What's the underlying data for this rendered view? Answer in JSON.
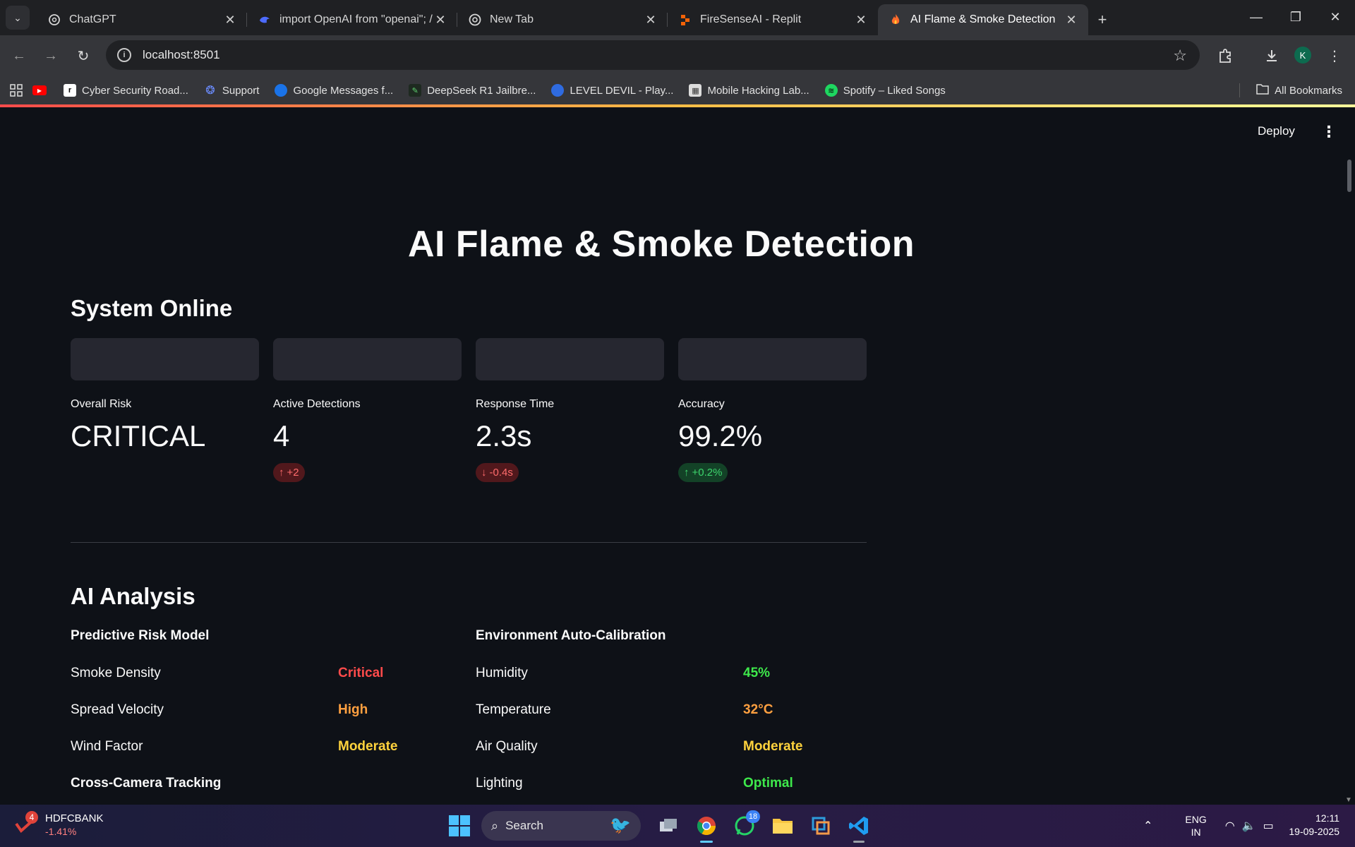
{
  "browser": {
    "tabs": [
      {
        "title": "ChatGPT",
        "icon": "chatgpt-icon"
      },
      {
        "title": "import OpenAI from \"openai\"; /",
        "icon": "deepseek-icon"
      },
      {
        "title": "New Tab",
        "icon": "chrome-icon"
      },
      {
        "title": "FireSenseAI - Replit",
        "icon": "replit-icon"
      },
      {
        "title": "AI Flame & Smoke Detection",
        "icon": "fire-icon",
        "active": true
      }
    ],
    "url": "localhost:8501",
    "profile_initial": "K",
    "bookmarks": [
      {
        "label": "Cyber Security Road...",
        "icon": "roadmap-icon"
      },
      {
        "label": "Support",
        "icon": "support-icon"
      },
      {
        "label": "Google Messages f...",
        "icon": "messages-icon"
      },
      {
        "label": "DeepSeek R1 Jailbre...",
        "icon": "deepseek-icon"
      },
      {
        "label": "LEVEL DEVIL - Play...",
        "icon": "game-icon"
      },
      {
        "label": "Mobile Hacking Lab...",
        "icon": "lab-icon"
      },
      {
        "label": "Spotify – Liked Songs",
        "icon": "spotify-icon"
      }
    ],
    "all_bookmarks": "All Bookmarks"
  },
  "app": {
    "deploy_label": "Deploy",
    "title": "AI Flame & Smoke Detection",
    "status_heading": "System Online",
    "metrics": [
      {
        "label": "Overall Risk",
        "value": "CRITICAL",
        "delta": ""
      },
      {
        "label": "Active Detections",
        "value": "4",
        "delta": "+2",
        "direction": "up",
        "color": "red"
      },
      {
        "label": "Response Time",
        "value": "2.3s",
        "delta": "-0.4s",
        "direction": "down",
        "color": "red"
      },
      {
        "label": "Accuracy",
        "value": "99.2%",
        "delta": "+0.2%",
        "direction": "up",
        "color": "green"
      }
    ],
    "analysis_heading": "AI Analysis",
    "predictive": {
      "heading": "Predictive Risk Model",
      "rows": [
        {
          "label": "Smoke Density",
          "value": "Critical",
          "color": "#ff4b4b"
        },
        {
          "label": "Spread Velocity",
          "value": "High",
          "color": "#ffa040"
        },
        {
          "label": "Wind Factor",
          "value": "Moderate",
          "color": "#ffd33d"
        }
      ]
    },
    "tracking_heading": "Cross-Camera Tracking",
    "calibration": {
      "heading": "Environment Auto-Calibration",
      "rows": [
        {
          "label": "Humidity",
          "value": "45%",
          "color": "#3ee84b"
        },
        {
          "label": "Temperature",
          "value": "32°C",
          "color": "#ffa040"
        },
        {
          "label": "Air Quality",
          "value": "Moderate",
          "color": "#ffd33d"
        },
        {
          "label": "Lighting",
          "value": "Optimal",
          "color": "#3ee84b"
        }
      ]
    }
  },
  "taskbar": {
    "stock_name": "HDFCBANK",
    "stock_change": "-1.41%",
    "stock_badge": "4",
    "search_label": "Search",
    "whatsapp_badge": "18",
    "lang_line1": "ENG",
    "lang_line2": "IN",
    "time": "12:11",
    "date": "19-09-2025"
  }
}
